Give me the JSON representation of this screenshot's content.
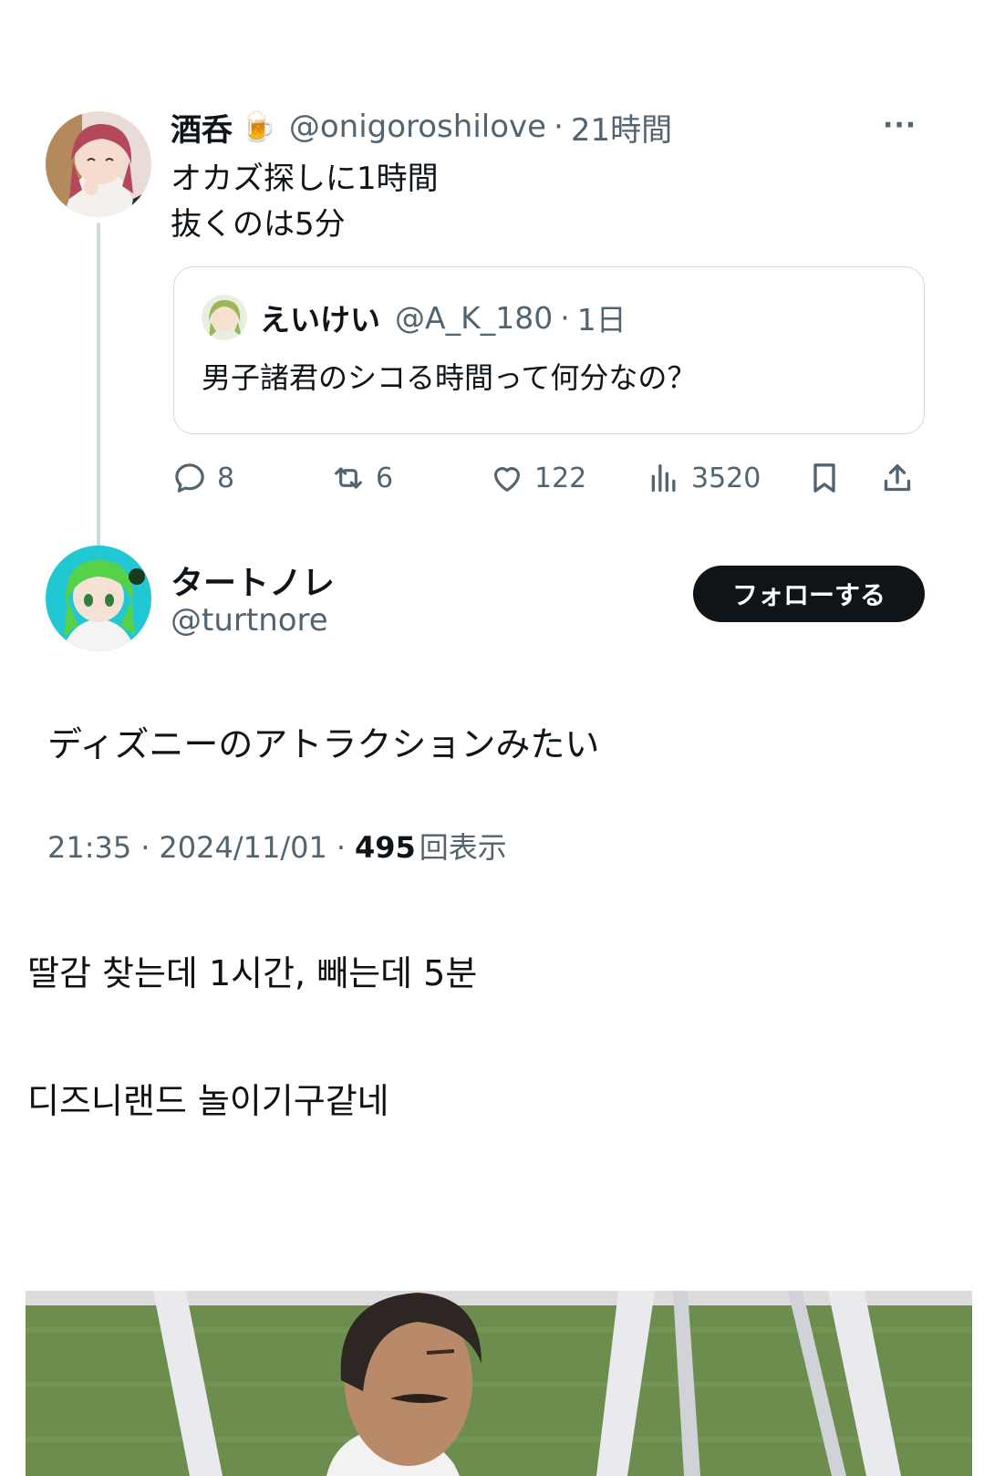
{
  "tweet1": {
    "display_name": "酒呑",
    "name_emoji": "🍺",
    "handle": "@onigoroshilove",
    "separator": "·",
    "time": "21時間",
    "more_label": "···",
    "lines": [
      "オカズ探しに1時間",
      "抜くのは5分"
    ],
    "quote": {
      "display_name": "えいけい",
      "handle": "@A_K_180",
      "separator": "·",
      "time": "1日",
      "text": "男子諸君のシコる時間って何分なの？"
    },
    "actions": {
      "replies": "8",
      "retweets": "6",
      "likes": "122",
      "views": "3520"
    }
  },
  "tweet2": {
    "display_name": "タートノレ",
    "handle": "@turtnore",
    "follow_label": "フォローする",
    "text": "ディズニーのアトラクションみたい",
    "meta": {
      "time": "21:35",
      "sep1": "·",
      "date": "2024/11/01",
      "sep2": "·",
      "views_count": "495",
      "views_label": "回表示"
    }
  },
  "post": {
    "line1": "딸감 찾는데 1시간, 빼는데 5분",
    "line2": "디즈니랜드 놀이기구같네"
  },
  "colors": {
    "text": "#0f1419",
    "muted": "#536471",
    "border": "#cfd9de",
    "button_bg": "#0f1419"
  }
}
